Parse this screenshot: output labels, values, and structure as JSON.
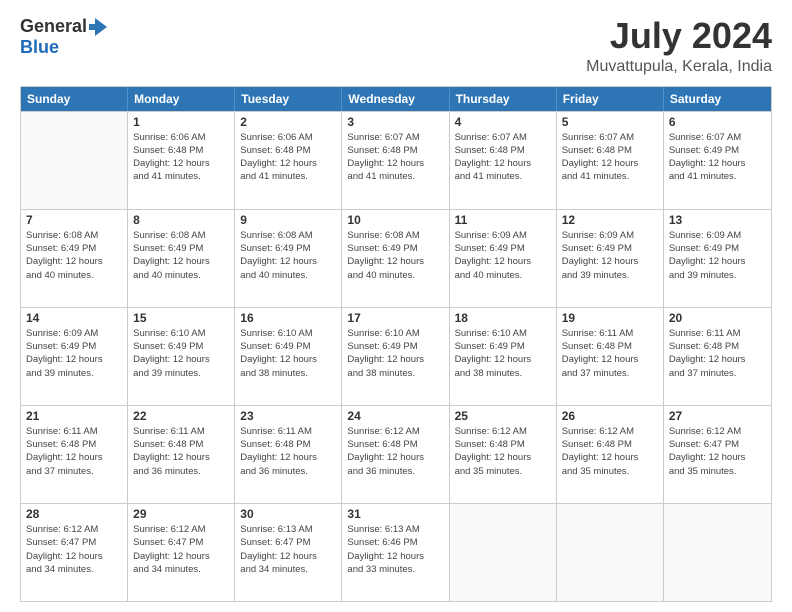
{
  "logo": {
    "line1": "General",
    "line2": "Blue"
  },
  "title": "July 2024",
  "location": "Muvattupula, Kerala, India",
  "header_days": [
    "Sunday",
    "Monday",
    "Tuesday",
    "Wednesday",
    "Thursday",
    "Friday",
    "Saturday"
  ],
  "weeks": [
    [
      {
        "day": "",
        "info": ""
      },
      {
        "day": "1",
        "info": "Sunrise: 6:06 AM\nSunset: 6:48 PM\nDaylight: 12 hours\nand 41 minutes."
      },
      {
        "day": "2",
        "info": "Sunrise: 6:06 AM\nSunset: 6:48 PM\nDaylight: 12 hours\nand 41 minutes."
      },
      {
        "day": "3",
        "info": "Sunrise: 6:07 AM\nSunset: 6:48 PM\nDaylight: 12 hours\nand 41 minutes."
      },
      {
        "day": "4",
        "info": "Sunrise: 6:07 AM\nSunset: 6:48 PM\nDaylight: 12 hours\nand 41 minutes."
      },
      {
        "day": "5",
        "info": "Sunrise: 6:07 AM\nSunset: 6:48 PM\nDaylight: 12 hours\nand 41 minutes."
      },
      {
        "day": "6",
        "info": "Sunrise: 6:07 AM\nSunset: 6:49 PM\nDaylight: 12 hours\nand 41 minutes."
      }
    ],
    [
      {
        "day": "7",
        "info": "Sunrise: 6:08 AM\nSunset: 6:49 PM\nDaylight: 12 hours\nand 40 minutes."
      },
      {
        "day": "8",
        "info": "Sunrise: 6:08 AM\nSunset: 6:49 PM\nDaylight: 12 hours\nand 40 minutes."
      },
      {
        "day": "9",
        "info": "Sunrise: 6:08 AM\nSunset: 6:49 PM\nDaylight: 12 hours\nand 40 minutes."
      },
      {
        "day": "10",
        "info": "Sunrise: 6:08 AM\nSunset: 6:49 PM\nDaylight: 12 hours\nand 40 minutes."
      },
      {
        "day": "11",
        "info": "Sunrise: 6:09 AM\nSunset: 6:49 PM\nDaylight: 12 hours\nand 40 minutes."
      },
      {
        "day": "12",
        "info": "Sunrise: 6:09 AM\nSunset: 6:49 PM\nDaylight: 12 hours\nand 39 minutes."
      },
      {
        "day": "13",
        "info": "Sunrise: 6:09 AM\nSunset: 6:49 PM\nDaylight: 12 hours\nand 39 minutes."
      }
    ],
    [
      {
        "day": "14",
        "info": "Sunrise: 6:09 AM\nSunset: 6:49 PM\nDaylight: 12 hours\nand 39 minutes."
      },
      {
        "day": "15",
        "info": "Sunrise: 6:10 AM\nSunset: 6:49 PM\nDaylight: 12 hours\nand 39 minutes."
      },
      {
        "day": "16",
        "info": "Sunrise: 6:10 AM\nSunset: 6:49 PM\nDaylight: 12 hours\nand 38 minutes."
      },
      {
        "day": "17",
        "info": "Sunrise: 6:10 AM\nSunset: 6:49 PM\nDaylight: 12 hours\nand 38 minutes."
      },
      {
        "day": "18",
        "info": "Sunrise: 6:10 AM\nSunset: 6:49 PM\nDaylight: 12 hours\nand 38 minutes."
      },
      {
        "day": "19",
        "info": "Sunrise: 6:11 AM\nSunset: 6:48 PM\nDaylight: 12 hours\nand 37 minutes."
      },
      {
        "day": "20",
        "info": "Sunrise: 6:11 AM\nSunset: 6:48 PM\nDaylight: 12 hours\nand 37 minutes."
      }
    ],
    [
      {
        "day": "21",
        "info": "Sunrise: 6:11 AM\nSunset: 6:48 PM\nDaylight: 12 hours\nand 37 minutes."
      },
      {
        "day": "22",
        "info": "Sunrise: 6:11 AM\nSunset: 6:48 PM\nDaylight: 12 hours\nand 36 minutes."
      },
      {
        "day": "23",
        "info": "Sunrise: 6:11 AM\nSunset: 6:48 PM\nDaylight: 12 hours\nand 36 minutes."
      },
      {
        "day": "24",
        "info": "Sunrise: 6:12 AM\nSunset: 6:48 PM\nDaylight: 12 hours\nand 36 minutes."
      },
      {
        "day": "25",
        "info": "Sunrise: 6:12 AM\nSunset: 6:48 PM\nDaylight: 12 hours\nand 35 minutes."
      },
      {
        "day": "26",
        "info": "Sunrise: 6:12 AM\nSunset: 6:48 PM\nDaylight: 12 hours\nand 35 minutes."
      },
      {
        "day": "27",
        "info": "Sunrise: 6:12 AM\nSunset: 6:47 PM\nDaylight: 12 hours\nand 35 minutes."
      }
    ],
    [
      {
        "day": "28",
        "info": "Sunrise: 6:12 AM\nSunset: 6:47 PM\nDaylight: 12 hours\nand 34 minutes."
      },
      {
        "day": "29",
        "info": "Sunrise: 6:12 AM\nSunset: 6:47 PM\nDaylight: 12 hours\nand 34 minutes."
      },
      {
        "day": "30",
        "info": "Sunrise: 6:13 AM\nSunset: 6:47 PM\nDaylight: 12 hours\nand 34 minutes."
      },
      {
        "day": "31",
        "info": "Sunrise: 6:13 AM\nSunset: 6:46 PM\nDaylight: 12 hours\nand 33 minutes."
      },
      {
        "day": "",
        "info": ""
      },
      {
        "day": "",
        "info": ""
      },
      {
        "day": "",
        "info": ""
      }
    ]
  ]
}
